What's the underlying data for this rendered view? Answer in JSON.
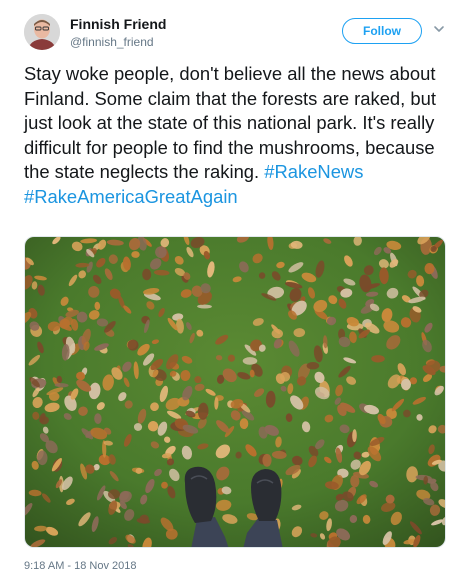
{
  "header": {
    "display_name": "Finnish Friend",
    "handle": "@finnish_friend",
    "follow_label": "Follow",
    "menu_icon": "chevron-down-icon",
    "avatar_icon": "avatar"
  },
  "tweet": {
    "text": "Stay woke people, don't believe all the news about Finland. Some claim that the forests are raked, but just look at the state of this national park. It's really difficult for people to find the mushrooms, because the state neglects the raking.",
    "hashtags": [
      "#RakeNews",
      "#RakeAmericaGreatAgain"
    ],
    "timestamp": "9:18 AM - 18 Nov 2018"
  },
  "colors": {
    "accent": "#1da1f2",
    "hashtag": "#1b95e0",
    "muted": "#657786",
    "text": "#14171a",
    "moss": "#4f7a2e",
    "leaf_palette": [
      "#c8893a",
      "#b8702e",
      "#d9a35a",
      "#9a5a2a",
      "#e2b77a",
      "#a86a3a",
      "#7a4a2a",
      "#d4c1a4",
      "#8c6a58"
    ]
  }
}
